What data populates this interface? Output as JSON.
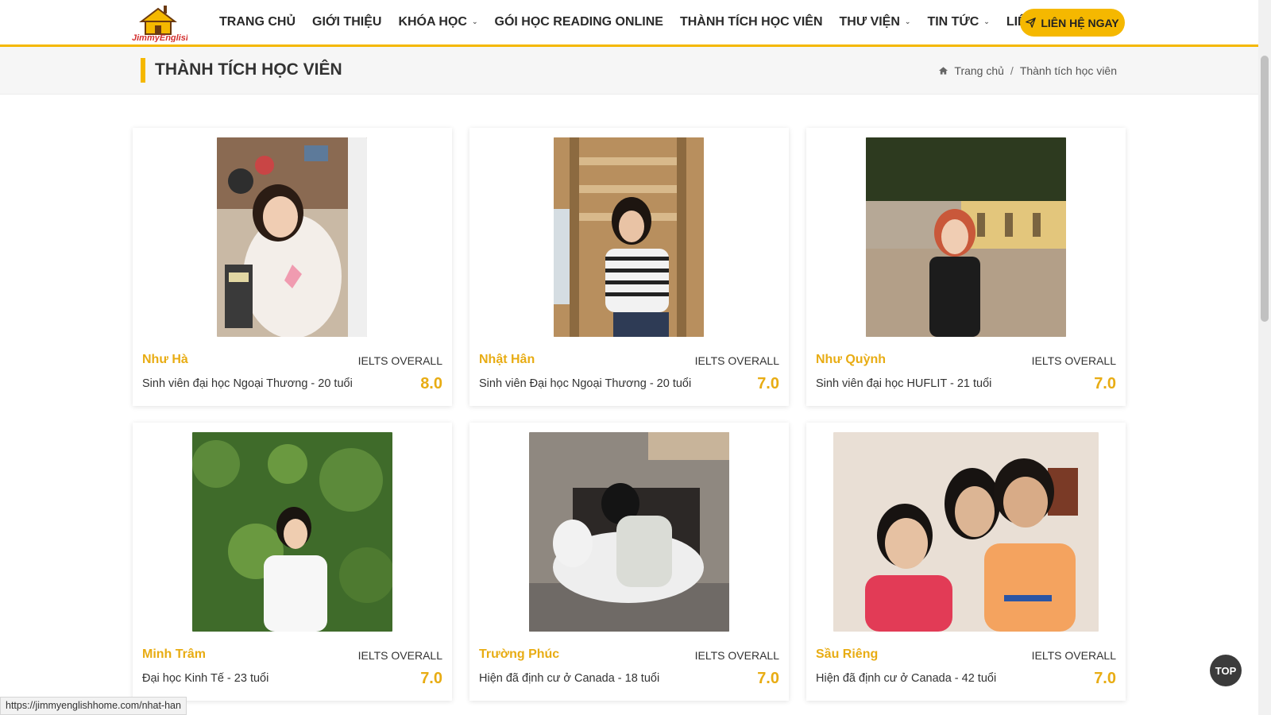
{
  "header": {
    "logo_text": "JimmyEnglish",
    "nav": [
      {
        "label": "TRANG CHỦ",
        "has_dropdown": false
      },
      {
        "label": "GIỚI THIỆU",
        "has_dropdown": false
      },
      {
        "label": "KHÓA HỌC",
        "has_dropdown": true
      },
      {
        "label": "GÓI HỌC READING ONLINE",
        "has_dropdown": false
      },
      {
        "label": "THÀNH TÍCH HỌC VIÊN",
        "has_dropdown": false
      },
      {
        "label": "THƯ VIỆN",
        "has_dropdown": true
      },
      {
        "label": "TIN TỨC",
        "has_dropdown": true
      },
      {
        "label": "LIÊN HỆ",
        "has_dropdown": false
      }
    ],
    "cta_label": "LIÊN HỆ NGAY"
  },
  "page": {
    "title": "THÀNH TÍCH HỌC VIÊN",
    "breadcrumb": {
      "home": "Trang chủ",
      "separator": "/",
      "current": "Thành tích học viên"
    }
  },
  "students": [
    {
      "name": "Như Hà",
      "label": "IELTS OVERALL",
      "desc": "Sinh viên đại học Ngoại Thương - 20 tuổi",
      "score": "8.0"
    },
    {
      "name": "Nhật Hân",
      "label": "IELTS OVERALL",
      "desc": "Sinh viên Đại học Ngoại Thương - 20 tuổi",
      "score": "7.0"
    },
    {
      "name": "Như Quỳnh",
      "label": "IELTS OVERALL",
      "desc": "Sinh viên đại học HUFLIT - 21 tuổi",
      "score": "7.0"
    },
    {
      "name": "Minh Trâm",
      "label": "IELTS OVERALL",
      "desc": "Đại học Kinh Tế - 23 tuổi",
      "score": "7.0"
    },
    {
      "name": "Trường Phúc",
      "label": "IELTS OVERALL",
      "desc": "Hiện đã định cư ở Canada - 18 tuổi",
      "score": "7.0"
    },
    {
      "name": "Sầu Riêng",
      "label": "IELTS OVERALL",
      "desc": "Hiện đã định cư ở Canada - 42 tuổi",
      "score": "7.0"
    }
  ],
  "top_button": "TOP",
  "status_url": "https://jimmyenglishhome.com/nhat-han",
  "colors": {
    "accent": "#f5b800",
    "name": "#e8ac13"
  }
}
